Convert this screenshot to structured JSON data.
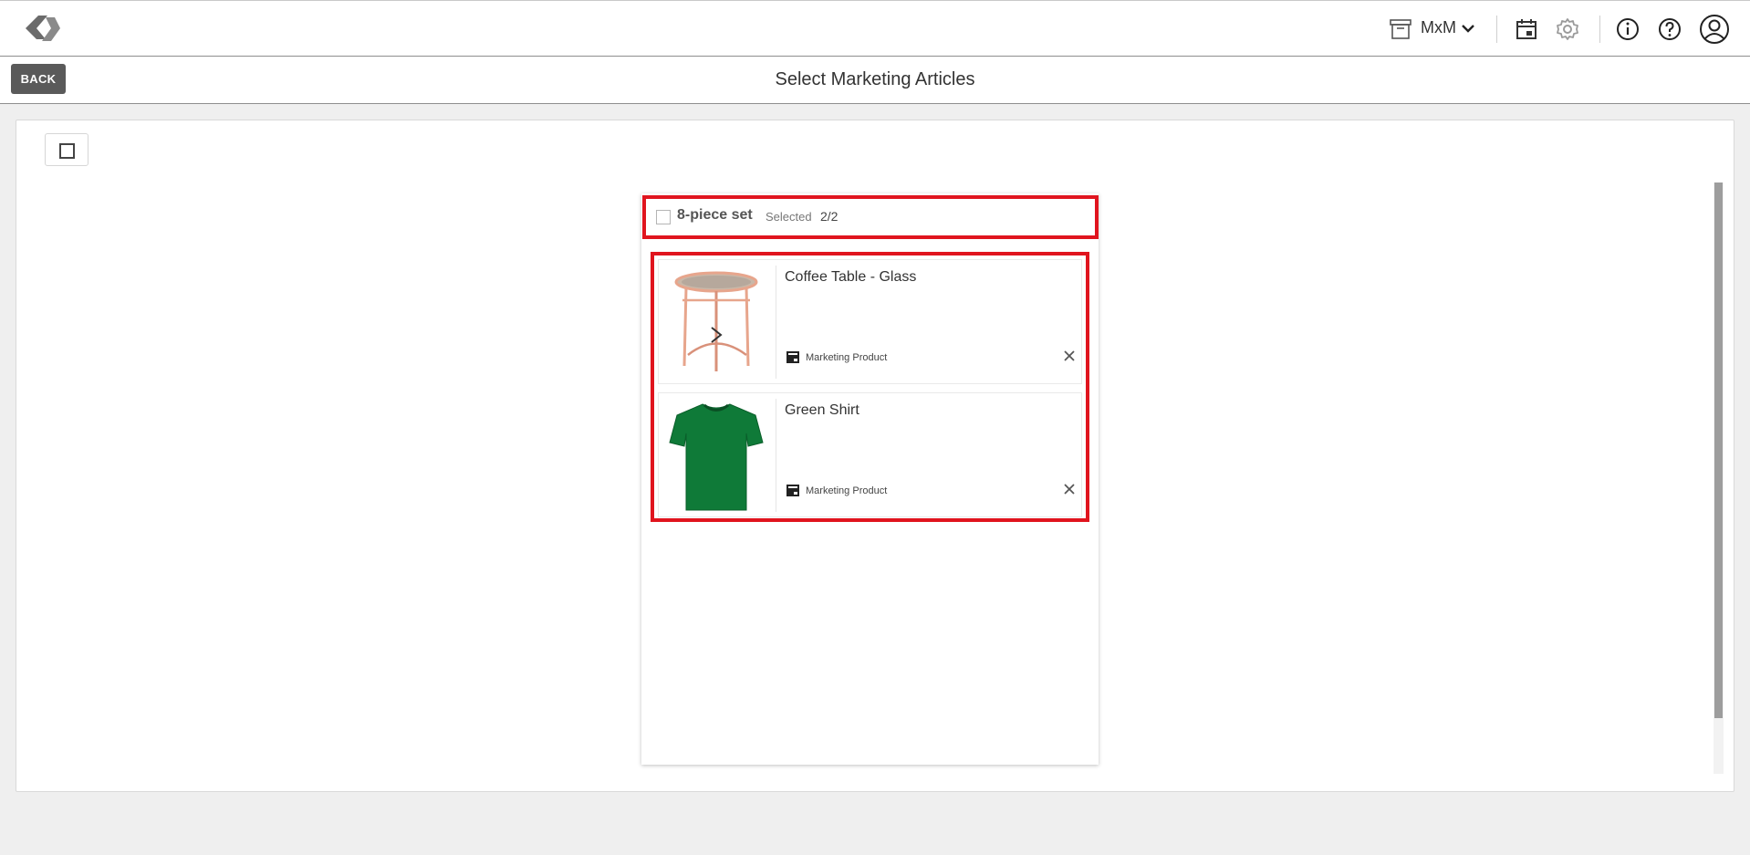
{
  "header": {
    "store_name": "MxM"
  },
  "subbar": {
    "back_label": "BACK",
    "title": "Select Marketing Articles"
  },
  "set": {
    "name": "8-piece set",
    "selected_label": "Selected",
    "selected_count": "2/2"
  },
  "items": [
    {
      "name": "Coffee Table - Glass",
      "type": "Marketing Product",
      "image": "glass-coffee-table"
    },
    {
      "name": "Green Shirt",
      "type": "Marketing Product",
      "image": "green-tshirt"
    }
  ],
  "colors": {
    "highlight": "#e0141e",
    "back_button": "#5a5a5a",
    "shirt": "#0f7a38",
    "table_frame": "#e7a58c"
  }
}
